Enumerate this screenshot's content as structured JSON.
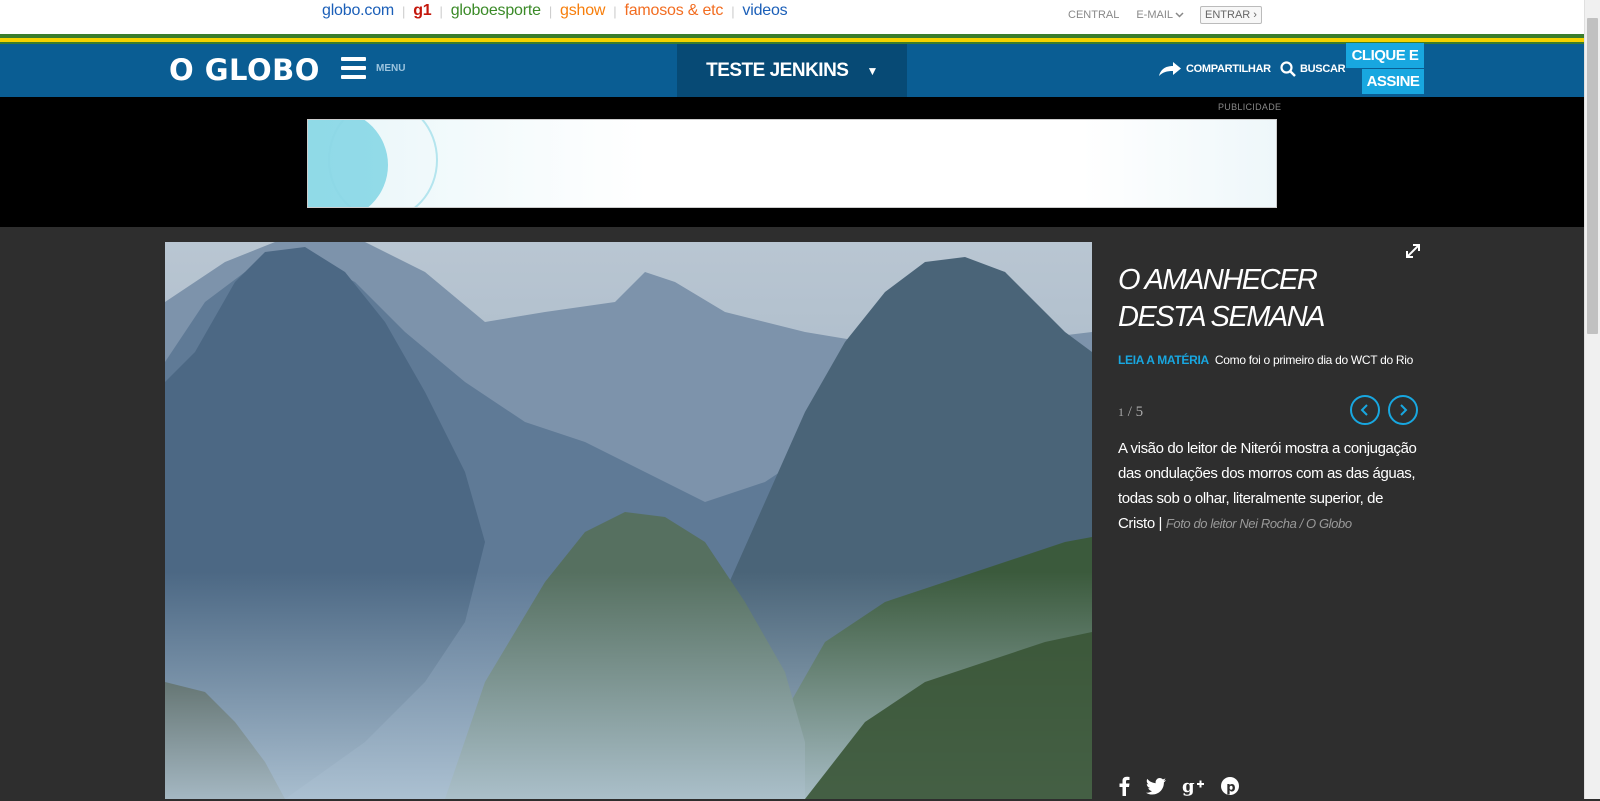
{
  "globo_bar": {
    "links": [
      {
        "label": "globo.com",
        "color": "#1b5fb8"
      },
      {
        "label": "g1",
        "color": "#c4170c"
      },
      {
        "label": "globoesporte",
        "color": "#3a8a27"
      },
      {
        "label": "gshow",
        "color": "#f77e0b"
      },
      {
        "label": "famosos & etc",
        "color": "#f26d21"
      },
      {
        "label": "videos",
        "color": "#1b5fb8"
      }
    ],
    "central": "CENTRAL",
    "email": "E-MAIL",
    "entrar": "ENTRAR ›"
  },
  "header": {
    "logo": "O GLOBO",
    "menu_label": "MENU",
    "section": "TESTE JENKINS",
    "share_label": "COMPARTILHAR",
    "search_label": "BUSCAR",
    "assine_line1": "CLIQUE E",
    "assine_line2": "ASSINE",
    "accent": "#18a7e0",
    "bar_color": "#0a5d93"
  },
  "ad": {
    "label": "PUBLICIDADE"
  },
  "gallery": {
    "title": "O AMANHECER DESTA SEMANA",
    "leia_label": "LEIA A MATÉRIA",
    "leia_text": "Como foi o primeiro dia do WCT do Rio",
    "counter_current": "1",
    "counter_total": "/ 5",
    "caption": "A visão do leitor de Niterói mostra a conjugação das ondulações dos morros com as das águas, todas sob o olhar, literalmente superior, de Cristo",
    "caption_sep": " | ",
    "credit": "Foto do leitor Nei Rocha / O Globo",
    "social": [
      {
        "icon": "facebook-icon",
        "glyph": "f"
      },
      {
        "icon": "twitter-icon",
        "glyph": "🐦"
      },
      {
        "icon": "google-plus-icon",
        "glyph": "g+"
      },
      {
        "icon": "pinterest-icon",
        "glyph": "℗"
      }
    ]
  }
}
